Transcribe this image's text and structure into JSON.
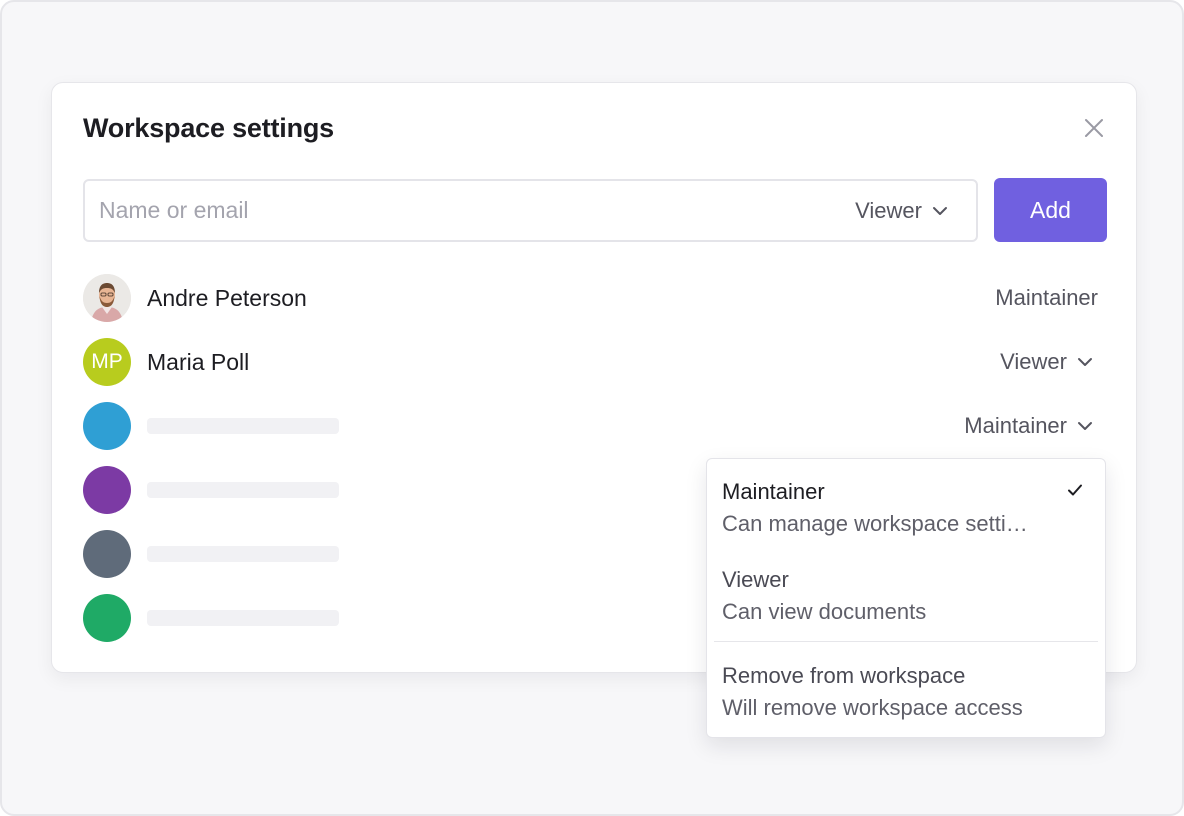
{
  "modal": {
    "title": "Workspace settings"
  },
  "invite": {
    "placeholder": "Name or email",
    "role": "Viewer",
    "add_label": "Add"
  },
  "members": [
    {
      "name": "Andre Peterson",
      "role": "Maintainer",
      "avatar": "photo",
      "has_dropdown": false
    },
    {
      "name": "Maria Poll",
      "initials": "MP",
      "role": "Viewer",
      "avatar_color": "#b8cc1e",
      "has_dropdown": true
    },
    {
      "name": "",
      "role": "Maintainer",
      "avatar_color": "#2f9fd4",
      "has_dropdown": true
    },
    {
      "name": "",
      "avatar_color": "#7c3aa4"
    },
    {
      "name": "",
      "avatar_color": "#5f6b7a"
    },
    {
      "name": "",
      "avatar_color": "#1faa66"
    }
  ],
  "role_menu": {
    "options": [
      {
        "title": "Maintainer",
        "description": "Can manage workspace setti…",
        "selected": true
      },
      {
        "title": "Viewer",
        "description": "Can view documents",
        "selected": false
      },
      {
        "title": "Remove from workspace",
        "description": "Will remove workspace access",
        "selected": false
      }
    ]
  },
  "colors": {
    "accent": "#7060e0",
    "page_bg": "#f7f7f9"
  },
  "icons": {
    "close": "close-icon",
    "chevron": "chevron-down-icon",
    "check": "check-icon"
  }
}
